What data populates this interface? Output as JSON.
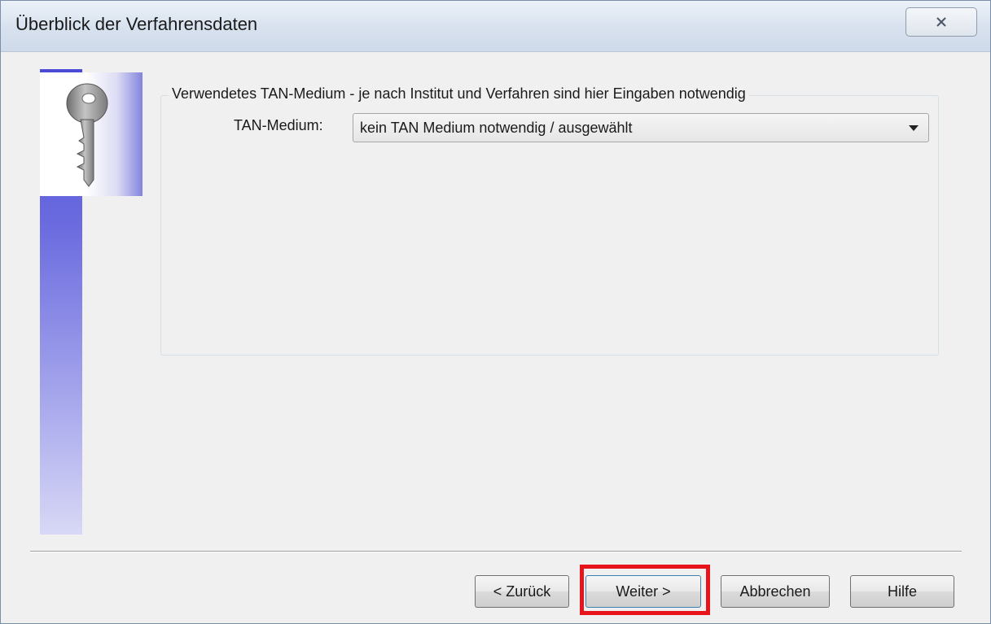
{
  "window": {
    "title": "Überblick der Verfahrensdaten",
    "close_icon": "close-icon"
  },
  "group": {
    "legend": "Verwendetes TAN-Medium - je nach Institut und Verfahren sind hier Eingaben notwendig"
  },
  "tan_medium": {
    "label": "TAN-Medium:",
    "selected": "kein TAN Medium notwendig / ausgewählt"
  },
  "buttons": {
    "back": "< Zurück",
    "next": "Weiter >",
    "cancel": "Abbrechen",
    "help": "Hilfe"
  },
  "icons": {
    "banner": "key-icon",
    "dropdown": "chevron-down-icon"
  },
  "colors": {
    "highlight": "#e8141c",
    "banner": "#4a4ad6"
  }
}
